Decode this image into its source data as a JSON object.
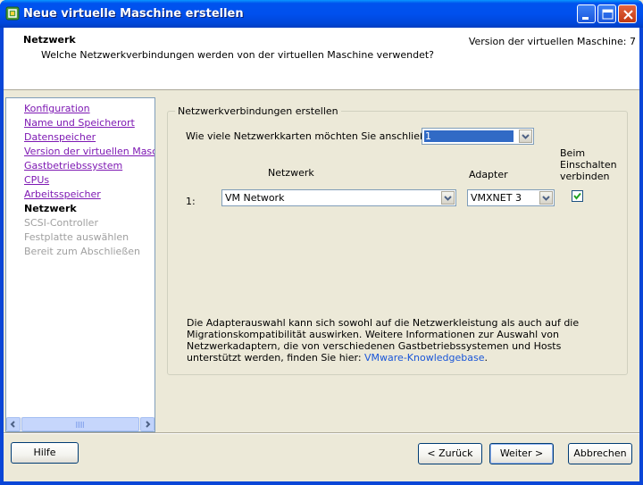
{
  "window": {
    "title": "Neue virtuelle Maschine erstellen"
  },
  "header": {
    "title": "Netzwerk",
    "subtitle": "Welche Netzwerkverbindungen werden von der virtuellen Maschine verwendet?",
    "version": "Version der virtuellen Maschine: 7"
  },
  "nav": {
    "items": [
      {
        "label": "Konfiguration",
        "state": "link"
      },
      {
        "label": "Name und Speicherort",
        "state": "link"
      },
      {
        "label": "Datenspeicher",
        "state": "link"
      },
      {
        "label": "Version der virtuellen Maschine",
        "state": "link"
      },
      {
        "label": "Gastbetriebssystem",
        "state": "link"
      },
      {
        "label": "CPUs",
        "state": "link"
      },
      {
        "label": "Arbeitsspeicher",
        "state": "link"
      },
      {
        "label": "Netzwerk",
        "state": "current"
      },
      {
        "label": "SCSI-Controller",
        "state": "disabled"
      },
      {
        "label": "Festplatte auswählen",
        "state": "disabled"
      },
      {
        "label": "Bereit zum Abschließen",
        "state": "disabled"
      }
    ]
  },
  "main": {
    "group_title": "Netzwerkverbindungen erstellen",
    "nic_question": "Wie viele Netzwerkkarten möchten Sie anschließen?",
    "nic_count": "1",
    "col_network": "Netzwerk",
    "col_adapter": "Adapter",
    "col_connect": "Beim Einschalten verbinden",
    "col_connect_lines": [
      "Beim",
      "Einschalten",
      "verbinden"
    ],
    "rows": [
      {
        "index": "1:",
        "network": "VM Network",
        "adapter": "VMXNET 3",
        "connect": true
      }
    ],
    "info_text": "Die Adapterauswahl kann sich sowohl auf die Netzwerkleistung als auch auf die Migrationskompatibilität auswirken. Weitere Informationen zur Auswahl von Netzwerkadaptern, die von verschiedenen Gastbetriebssystemen und Hosts unterstützt werden, finden Sie hier: ",
    "info_link": "VMware-Knowledgebase",
    "info_end": "."
  },
  "buttons": {
    "help": "Hilfe",
    "back": "< Zurück",
    "next": "Weiter >",
    "cancel": "Abbrechen"
  },
  "colors": {
    "titlebar": "#0053ee",
    "link": "#7e19b3",
    "disabled": "#a0a0a0",
    "kb_link": "#1a56d8",
    "selection": "#316ac5"
  }
}
